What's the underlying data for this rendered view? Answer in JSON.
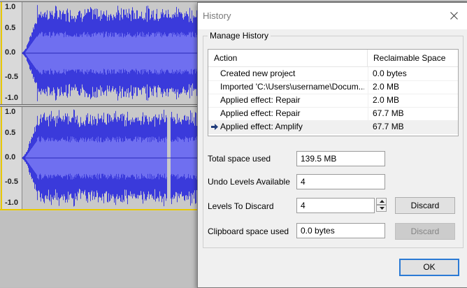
{
  "waveform": {
    "ticks": [
      "1.0",
      "0.5",
      "0.0",
      "-0.5",
      "-1.0"
    ],
    "color": "#3a3adb"
  },
  "dialog": {
    "title": "History",
    "group_title": "Manage History",
    "list": {
      "columns": [
        "Action",
        "Reclaimable Space"
      ],
      "rows": [
        {
          "action": "Created new project",
          "space": "0.0 bytes"
        },
        {
          "action": "Imported 'C:\\Users\\username\\Docum...",
          "space": "2.0 MB"
        },
        {
          "action": "Applied effect: Repair",
          "space": "2.0 MB"
        },
        {
          "action": "Applied effect: Repair",
          "space": "67.7 MB"
        },
        {
          "action": "Applied effect: Amplify",
          "space": "67.7 MB"
        }
      ],
      "current_row": 4
    },
    "total_space_label": "Total space used",
    "total_space_value": "139.5 MB",
    "undo_levels_label": "Undo Levels Available",
    "undo_levels_value": "4",
    "levels_discard_label": "Levels To Discard",
    "levels_discard_value": "4",
    "discard_label": "Discard",
    "clipboard_label": "Clipboard space used",
    "clipboard_value": "0.0 bytes",
    "discard_clipboard_label": "Discard",
    "ok_label": "OK",
    "accent": "#2a7ad5"
  }
}
